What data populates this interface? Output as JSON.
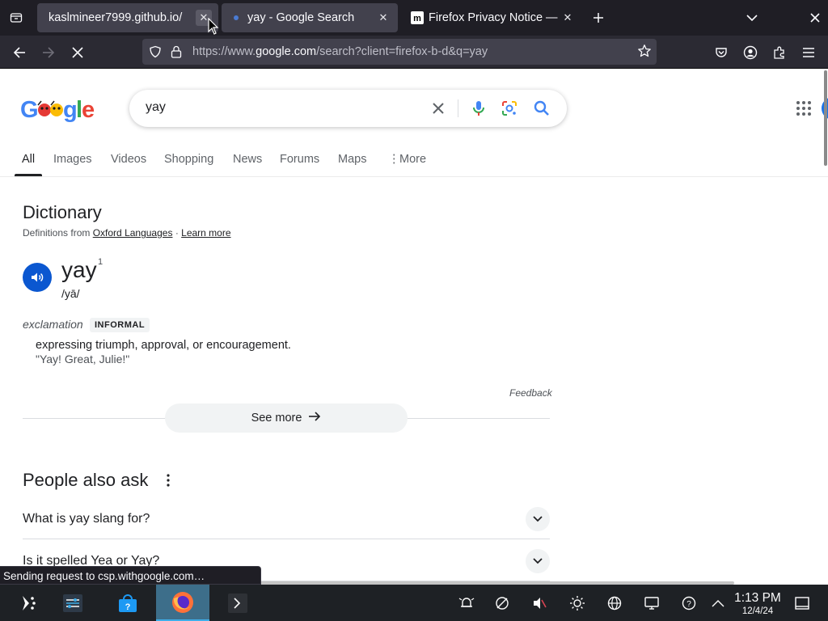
{
  "browser": {
    "tabs": [
      {
        "title": "kaslmineer7999.github.io/",
        "close": "✕"
      },
      {
        "title": "yay - Google Search",
        "close": "✕"
      },
      {
        "title": "Firefox Privacy Notice —",
        "close": "✕"
      }
    ],
    "new_tab": "+",
    "url_prefix": "https://www.",
    "url_host": "google.com",
    "url_rest": "/search?client=firefox-b-d&q=yay"
  },
  "google": {
    "query": "yay",
    "nav_tabs": [
      "All",
      "Images",
      "Videos",
      "Shopping",
      "News",
      "Forums",
      "Maps",
      "More"
    ]
  },
  "dictionary": {
    "title": "Dictionary",
    "source_prefix": "Definitions from",
    "source_link": "Oxford Languages",
    "separator": "·",
    "learn_more": "Learn more",
    "word": "yay",
    "superscript": "1",
    "phonetic": "/yā/",
    "part_of_speech": "exclamation",
    "register": "INFORMAL",
    "definition": "expressing triumph, approval, or encouragement.",
    "example": "\"Yay! Great, Julie!\"",
    "feedback": "Feedback",
    "see_more": "See more"
  },
  "people_also_ask": {
    "title": "People also ask",
    "questions": [
      "What is yay slang for?",
      "Is it spelled Yea or Yay?"
    ]
  },
  "status_text": "Sending request to csp.withgoogle.com…",
  "taskbar": {
    "time": "1:13 PM",
    "date": "12/4/24"
  },
  "colors": {
    "firefox_tabbar": "#1f1e25",
    "firefox_navbar": "#2b2a33",
    "google_blue": "#4285f4",
    "taskbar": "#1e2125"
  }
}
